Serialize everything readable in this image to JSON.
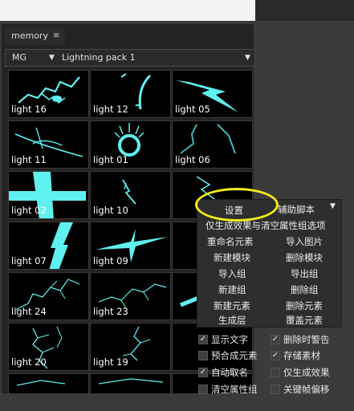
{
  "panel": {
    "tab_label": "memory",
    "tab_menu_glyph": "≡",
    "category": "MG",
    "pack": "Lightning pack 1"
  },
  "tiles": [
    "light 16",
    "light 12",
    "light 05",
    "light 11",
    "light 01",
    "light 06",
    "light 02",
    "light 10",
    "",
    "light 07",
    "light 09",
    "",
    "light 24",
    "light 23",
    "",
    "light 20",
    "light 19",
    ""
  ],
  "accent": "#5ff0f0",
  "context_menu": {
    "settings": "设置",
    "helper": "辅助脚本",
    "gen_effect": "仅生成效果与清空属性组选项",
    "rename": "重命名元素",
    "import_image": "导入图片",
    "new_module": "新建模块",
    "delete_module": "删除模块",
    "import_group": "导入组",
    "export_group": "导出组",
    "new_group": "新建组",
    "delete_group": "删除组",
    "new_element": "新建元素",
    "delete_element": "删除元素",
    "generate_layer": "生成层",
    "overwrite_element": "覆盖元素"
  },
  "options": {
    "show_text": "显示文字",
    "delete_warning": "删除时警告",
    "precomp": "预合成元素",
    "store_material": "存储素材",
    "auto_name": "自动取名",
    "effect_only": "仅生成效果",
    "clear_props": "清空属性组",
    "keyframe_offset": "关键帧偏移"
  }
}
